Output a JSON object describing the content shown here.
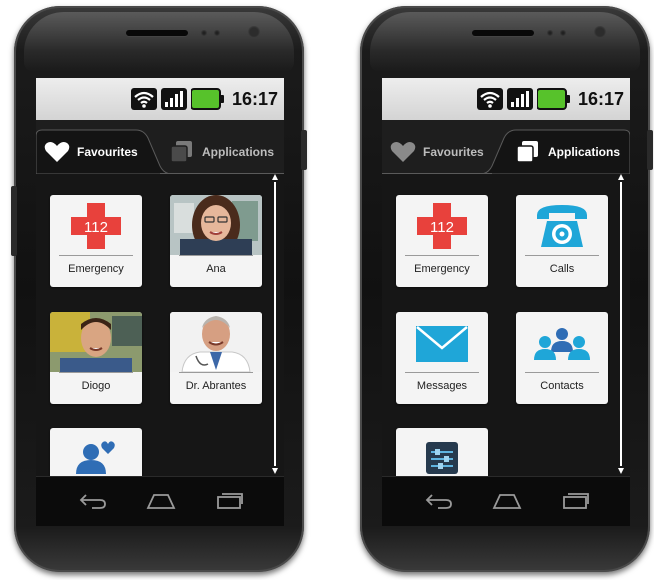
{
  "status": {
    "time": "16:17"
  },
  "tabs": {
    "favourites": "Favourites",
    "applications": "Applications"
  },
  "favourites": [
    {
      "label": "Emergency",
      "badge": "112",
      "icon": "emergency-cross-icon"
    },
    {
      "label": "Ana",
      "icon": "photo-woman"
    },
    {
      "label": "Diogo",
      "icon": "photo-man"
    },
    {
      "label": "Dr. Abrantes",
      "icon": "photo-doctor"
    },
    {
      "label": "",
      "icon": "add-favourite-icon"
    }
  ],
  "applications": [
    {
      "label": "Emergency",
      "badge": "112",
      "icon": "emergency-cross-icon"
    },
    {
      "label": "Calls",
      "icon": "telephone-icon"
    },
    {
      "label": "Messages",
      "icon": "envelope-icon"
    },
    {
      "label": "Contacts",
      "icon": "contacts-group-icon"
    },
    {
      "label": "",
      "icon": "settings-sliders-icon"
    }
  ],
  "colors": {
    "emergency_red": "#e8413c",
    "app_blue": "#1fa6d8",
    "fav_blue": "#2f6db5",
    "status_green": "#57c22b"
  }
}
